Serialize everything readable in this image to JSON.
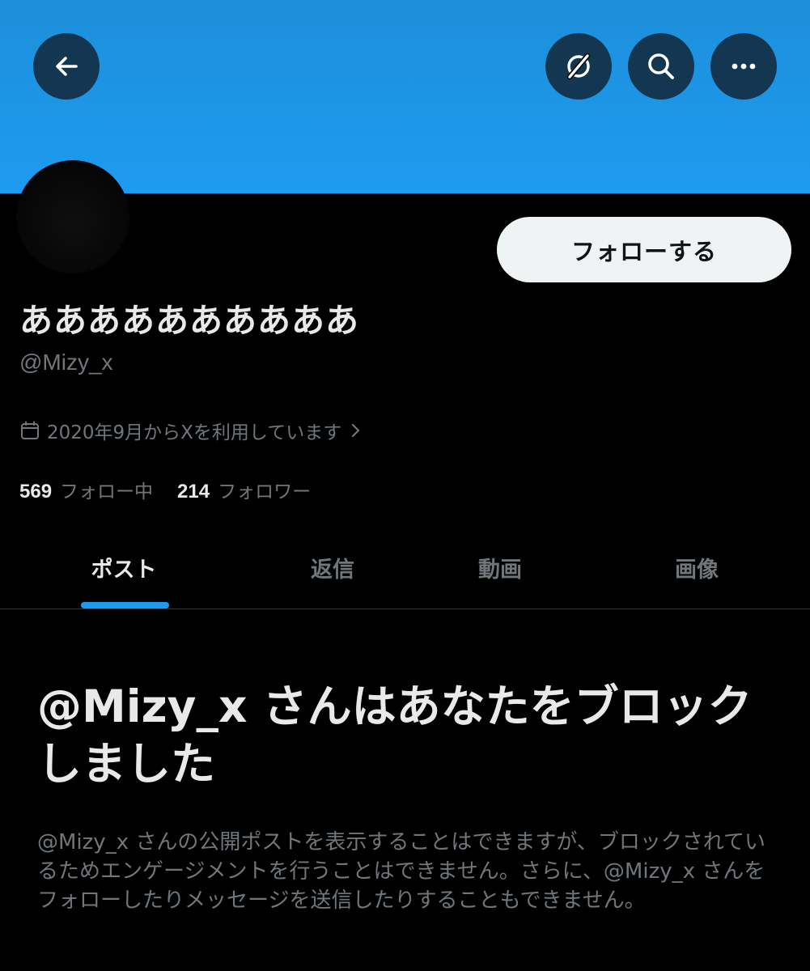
{
  "header": {
    "back_icon": "arrow-left-icon",
    "actions": [
      "no-circle-icon",
      "search-icon",
      "more-icon"
    ],
    "banner_color": "#1d9bf0"
  },
  "profile": {
    "display_name": "ああああああああああ",
    "handle": "@Mizy_x",
    "follow_label": "フォローする",
    "joined_text": "2020年9月からXを利用しています",
    "following_count": "569",
    "following_label": "フォロー中",
    "followers_count": "214",
    "followers_label": "フォロワー"
  },
  "tabs": [
    {
      "label": "ポスト",
      "active": true
    },
    {
      "label": "返信",
      "active": false
    },
    {
      "label": "動画",
      "active": false
    },
    {
      "label": "画像",
      "active": false
    }
  ],
  "blocked_notice": {
    "title": "@Mizy_x さんはあなたをブロックしました",
    "description": "@Mizy_x さんの公開ポストを表示することはできますが、ブロックされているためエンゲージメントを行うことはできません。さらに、@Mizy_x さんをフォローしたりメッセージを送信したりすることもできません。"
  },
  "colors": {
    "accent": "#1d9bf0",
    "background": "#000000",
    "secondary_text": "#71767b",
    "primary_text": "#e7e9ea"
  }
}
